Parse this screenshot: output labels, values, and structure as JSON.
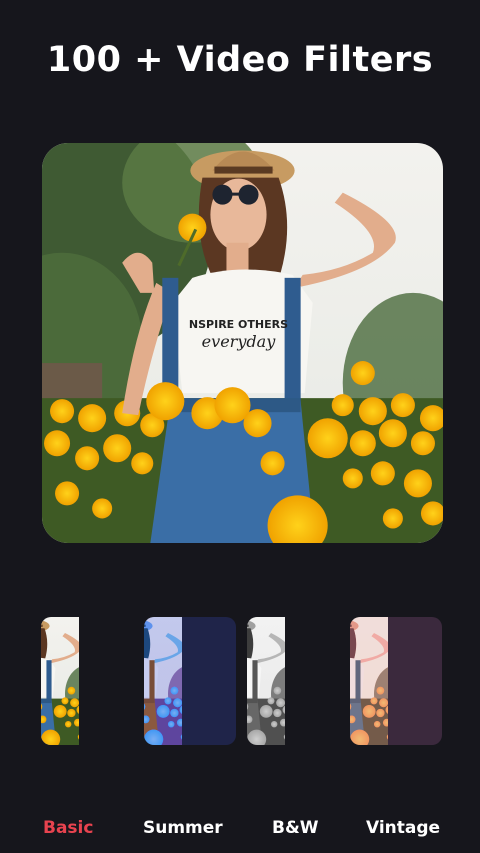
{
  "header": {
    "title": "100 + Video Filters"
  },
  "preview": {
    "shirt_line1": "NSPIRE OTHERS",
    "shirt_line2": "everyday"
  },
  "filters": {
    "tabs": [
      {
        "label": "Basic",
        "active": true
      },
      {
        "label": "Summer",
        "active": false
      },
      {
        "label": "B&W",
        "active": false
      },
      {
        "label": "Vintage",
        "active": false
      }
    ]
  },
  "colors": {
    "background": "#16161c",
    "accent": "#e8434f",
    "text": "#ffffff"
  }
}
